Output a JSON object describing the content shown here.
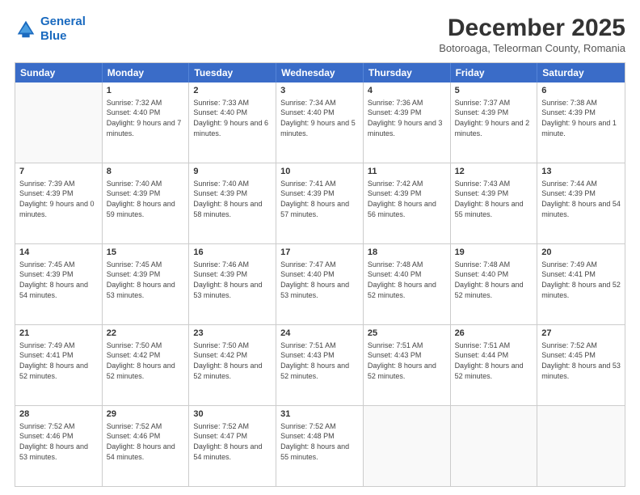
{
  "logo": {
    "line1": "General",
    "line2": "Blue"
  },
  "header": {
    "title": "December 2025",
    "location": "Botoroaga, Teleorman County, Romania"
  },
  "weekdays": [
    "Sunday",
    "Monday",
    "Tuesday",
    "Wednesday",
    "Thursday",
    "Friday",
    "Saturday"
  ],
  "weeks": [
    [
      {
        "day": "",
        "empty": true
      },
      {
        "day": "1",
        "sunrise": "Sunrise: 7:32 AM",
        "sunset": "Sunset: 4:40 PM",
        "daylight": "Daylight: 9 hours and 7 minutes."
      },
      {
        "day": "2",
        "sunrise": "Sunrise: 7:33 AM",
        "sunset": "Sunset: 4:40 PM",
        "daylight": "Daylight: 9 hours and 6 minutes."
      },
      {
        "day": "3",
        "sunrise": "Sunrise: 7:34 AM",
        "sunset": "Sunset: 4:40 PM",
        "daylight": "Daylight: 9 hours and 5 minutes."
      },
      {
        "day": "4",
        "sunrise": "Sunrise: 7:36 AM",
        "sunset": "Sunset: 4:39 PM",
        "daylight": "Daylight: 9 hours and 3 minutes."
      },
      {
        "day": "5",
        "sunrise": "Sunrise: 7:37 AM",
        "sunset": "Sunset: 4:39 PM",
        "daylight": "Daylight: 9 hours and 2 minutes."
      },
      {
        "day": "6",
        "sunrise": "Sunrise: 7:38 AM",
        "sunset": "Sunset: 4:39 PM",
        "daylight": "Daylight: 9 hours and 1 minute."
      }
    ],
    [
      {
        "day": "7",
        "sunrise": "Sunrise: 7:39 AM",
        "sunset": "Sunset: 4:39 PM",
        "daylight": "Daylight: 9 hours and 0 minutes."
      },
      {
        "day": "8",
        "sunrise": "Sunrise: 7:40 AM",
        "sunset": "Sunset: 4:39 PM",
        "daylight": "Daylight: 8 hours and 59 minutes."
      },
      {
        "day": "9",
        "sunrise": "Sunrise: 7:40 AM",
        "sunset": "Sunset: 4:39 PM",
        "daylight": "Daylight: 8 hours and 58 minutes."
      },
      {
        "day": "10",
        "sunrise": "Sunrise: 7:41 AM",
        "sunset": "Sunset: 4:39 PM",
        "daylight": "Daylight: 8 hours and 57 minutes."
      },
      {
        "day": "11",
        "sunrise": "Sunrise: 7:42 AM",
        "sunset": "Sunset: 4:39 PM",
        "daylight": "Daylight: 8 hours and 56 minutes."
      },
      {
        "day": "12",
        "sunrise": "Sunrise: 7:43 AM",
        "sunset": "Sunset: 4:39 PM",
        "daylight": "Daylight: 8 hours and 55 minutes."
      },
      {
        "day": "13",
        "sunrise": "Sunrise: 7:44 AM",
        "sunset": "Sunset: 4:39 PM",
        "daylight": "Daylight: 8 hours and 54 minutes."
      }
    ],
    [
      {
        "day": "14",
        "sunrise": "Sunrise: 7:45 AM",
        "sunset": "Sunset: 4:39 PM",
        "daylight": "Daylight: 8 hours and 54 minutes."
      },
      {
        "day": "15",
        "sunrise": "Sunrise: 7:45 AM",
        "sunset": "Sunset: 4:39 PM",
        "daylight": "Daylight: 8 hours and 53 minutes."
      },
      {
        "day": "16",
        "sunrise": "Sunrise: 7:46 AM",
        "sunset": "Sunset: 4:39 PM",
        "daylight": "Daylight: 8 hours and 53 minutes."
      },
      {
        "day": "17",
        "sunrise": "Sunrise: 7:47 AM",
        "sunset": "Sunset: 4:40 PM",
        "daylight": "Daylight: 8 hours and 53 minutes."
      },
      {
        "day": "18",
        "sunrise": "Sunrise: 7:48 AM",
        "sunset": "Sunset: 4:40 PM",
        "daylight": "Daylight: 8 hours and 52 minutes."
      },
      {
        "day": "19",
        "sunrise": "Sunrise: 7:48 AM",
        "sunset": "Sunset: 4:40 PM",
        "daylight": "Daylight: 8 hours and 52 minutes."
      },
      {
        "day": "20",
        "sunrise": "Sunrise: 7:49 AM",
        "sunset": "Sunset: 4:41 PM",
        "daylight": "Daylight: 8 hours and 52 minutes."
      }
    ],
    [
      {
        "day": "21",
        "sunrise": "Sunrise: 7:49 AM",
        "sunset": "Sunset: 4:41 PM",
        "daylight": "Daylight: 8 hours and 52 minutes."
      },
      {
        "day": "22",
        "sunrise": "Sunrise: 7:50 AM",
        "sunset": "Sunset: 4:42 PM",
        "daylight": "Daylight: 8 hours and 52 minutes."
      },
      {
        "day": "23",
        "sunrise": "Sunrise: 7:50 AM",
        "sunset": "Sunset: 4:42 PM",
        "daylight": "Daylight: 8 hours and 52 minutes."
      },
      {
        "day": "24",
        "sunrise": "Sunrise: 7:51 AM",
        "sunset": "Sunset: 4:43 PM",
        "daylight": "Daylight: 8 hours and 52 minutes."
      },
      {
        "day": "25",
        "sunrise": "Sunrise: 7:51 AM",
        "sunset": "Sunset: 4:43 PM",
        "daylight": "Daylight: 8 hours and 52 minutes."
      },
      {
        "day": "26",
        "sunrise": "Sunrise: 7:51 AM",
        "sunset": "Sunset: 4:44 PM",
        "daylight": "Daylight: 8 hours and 52 minutes."
      },
      {
        "day": "27",
        "sunrise": "Sunrise: 7:52 AM",
        "sunset": "Sunset: 4:45 PM",
        "daylight": "Daylight: 8 hours and 53 minutes."
      }
    ],
    [
      {
        "day": "28",
        "sunrise": "Sunrise: 7:52 AM",
        "sunset": "Sunset: 4:46 PM",
        "daylight": "Daylight: 8 hours and 53 minutes."
      },
      {
        "day": "29",
        "sunrise": "Sunrise: 7:52 AM",
        "sunset": "Sunset: 4:46 PM",
        "daylight": "Daylight: 8 hours and 54 minutes."
      },
      {
        "day": "30",
        "sunrise": "Sunrise: 7:52 AM",
        "sunset": "Sunset: 4:47 PM",
        "daylight": "Daylight: 8 hours and 54 minutes."
      },
      {
        "day": "31",
        "sunrise": "Sunrise: 7:52 AM",
        "sunset": "Sunset: 4:48 PM",
        "daylight": "Daylight: 8 hours and 55 minutes."
      },
      {
        "day": "",
        "empty": true
      },
      {
        "day": "",
        "empty": true
      },
      {
        "day": "",
        "empty": true
      }
    ]
  ]
}
